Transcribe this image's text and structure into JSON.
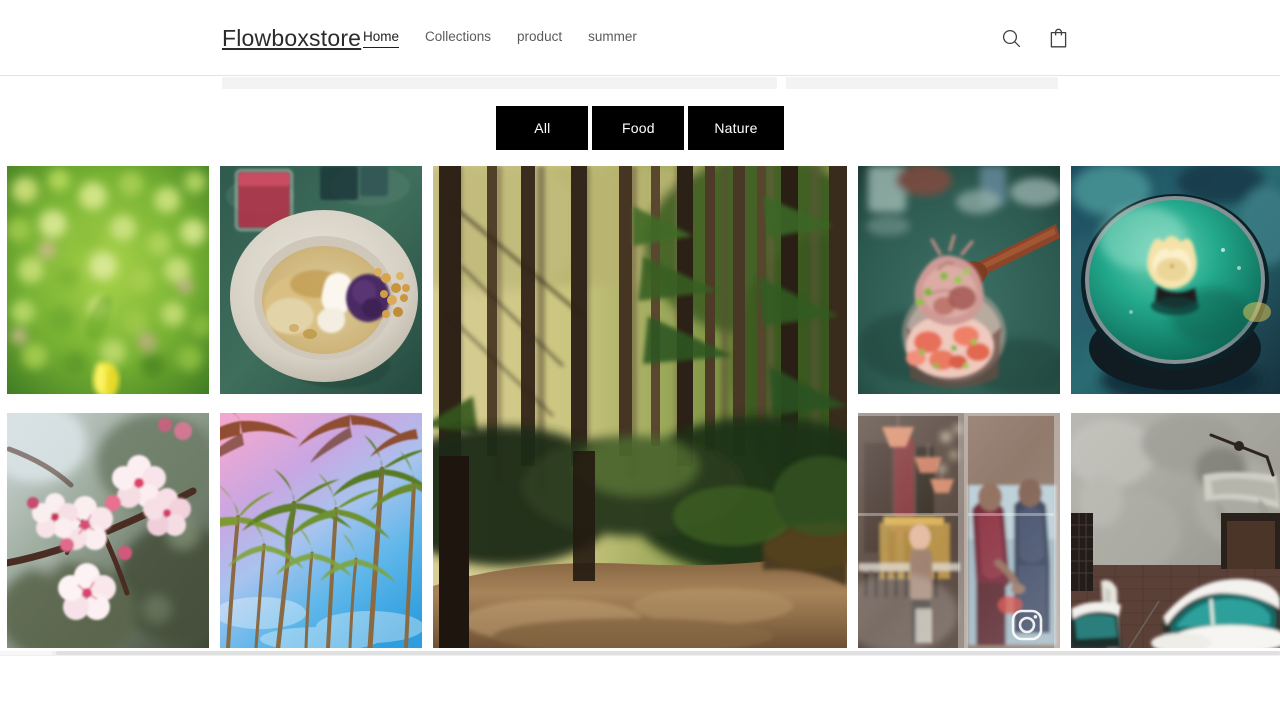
{
  "header": {
    "brand": "Flowboxstore",
    "nav": [
      {
        "label": "Home",
        "active": true
      },
      {
        "label": "Collections",
        "active": false
      },
      {
        "label": "product",
        "active": false
      },
      {
        "label": "summer",
        "active": false
      }
    ],
    "actions": [
      {
        "name": "search-icon",
        "label": "Search"
      },
      {
        "name": "cart-icon",
        "label": "Cart"
      }
    ]
  },
  "filters": {
    "buttons": [
      {
        "label": "All",
        "selected": true
      },
      {
        "label": "Food",
        "selected": false
      },
      {
        "label": "Nature",
        "selected": false
      }
    ],
    "background": "#000000",
    "text_color": "#ffffff"
  },
  "gallery": {
    "items": [
      {
        "id": "leaves",
        "alt": "Green bokeh foliage with a single yellow flower",
        "category": "Nature"
      },
      {
        "id": "dessert",
        "alt": "Dessert bowl with cream, purple rice and granola beside a red drink",
        "category": "Food"
      },
      {
        "id": "forest",
        "alt": "Tall forest trees lining a sunlit dirt path",
        "category": "Nature"
      },
      {
        "id": "tartare",
        "alt": "Tuna tartare served in a glass with a wooden spoon",
        "category": "Food"
      },
      {
        "id": "teal",
        "alt": "Teal bowl with a small yellow garnish",
        "category": "Food"
      },
      {
        "id": "blossom",
        "alt": "Pink cherry blossom branch in bloom",
        "category": "Nature"
      },
      {
        "id": "palms",
        "alt": "Palm trees against a pink and blue sky",
        "category": "Nature"
      },
      {
        "id": "window",
        "alt": "Retail storefront window with activewear display",
        "category": "Food",
        "badge": "instagram-icon"
      },
      {
        "id": "car",
        "alt": "Snow covered vintage car beside a weathered wall",
        "category": "Nature"
      }
    ]
  },
  "colors": {
    "page_background": "#ffffff",
    "header_border": "#e3e3e3",
    "nav_text": "#5b5b5b",
    "nav_active": "#1f1f1f",
    "ghost_bar": "#f3f3f3",
    "scrollbar": "#e0e0e0"
  }
}
